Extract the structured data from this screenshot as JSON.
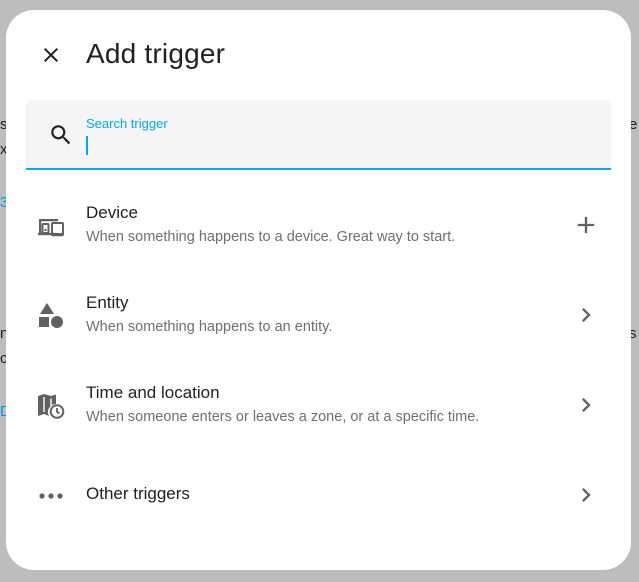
{
  "dialog": {
    "title": "Add trigger",
    "close_icon": "close-icon"
  },
  "search": {
    "label": "Search trigger",
    "value": "",
    "icon": "search-icon",
    "accent": "#03a9f4"
  },
  "items": [
    {
      "title": "Device",
      "description": "When something happens to a device. Great way to start.",
      "icon": "devices-icon",
      "trailing_icon": "plus-icon"
    },
    {
      "title": "Entity",
      "description": "When something happens to an entity.",
      "icon": "shapes-icon",
      "trailing_icon": "chevron-right-icon"
    },
    {
      "title": "Time and location",
      "description": "When someone enters or leaves a zone, or at a specific time.",
      "icon": "map-clock-icon",
      "trailing_icon": "chevron-right-icon"
    },
    {
      "title": "Other triggers",
      "icon": "dots-horizontal-icon",
      "trailing_icon": "chevron-right-icon"
    }
  ]
}
